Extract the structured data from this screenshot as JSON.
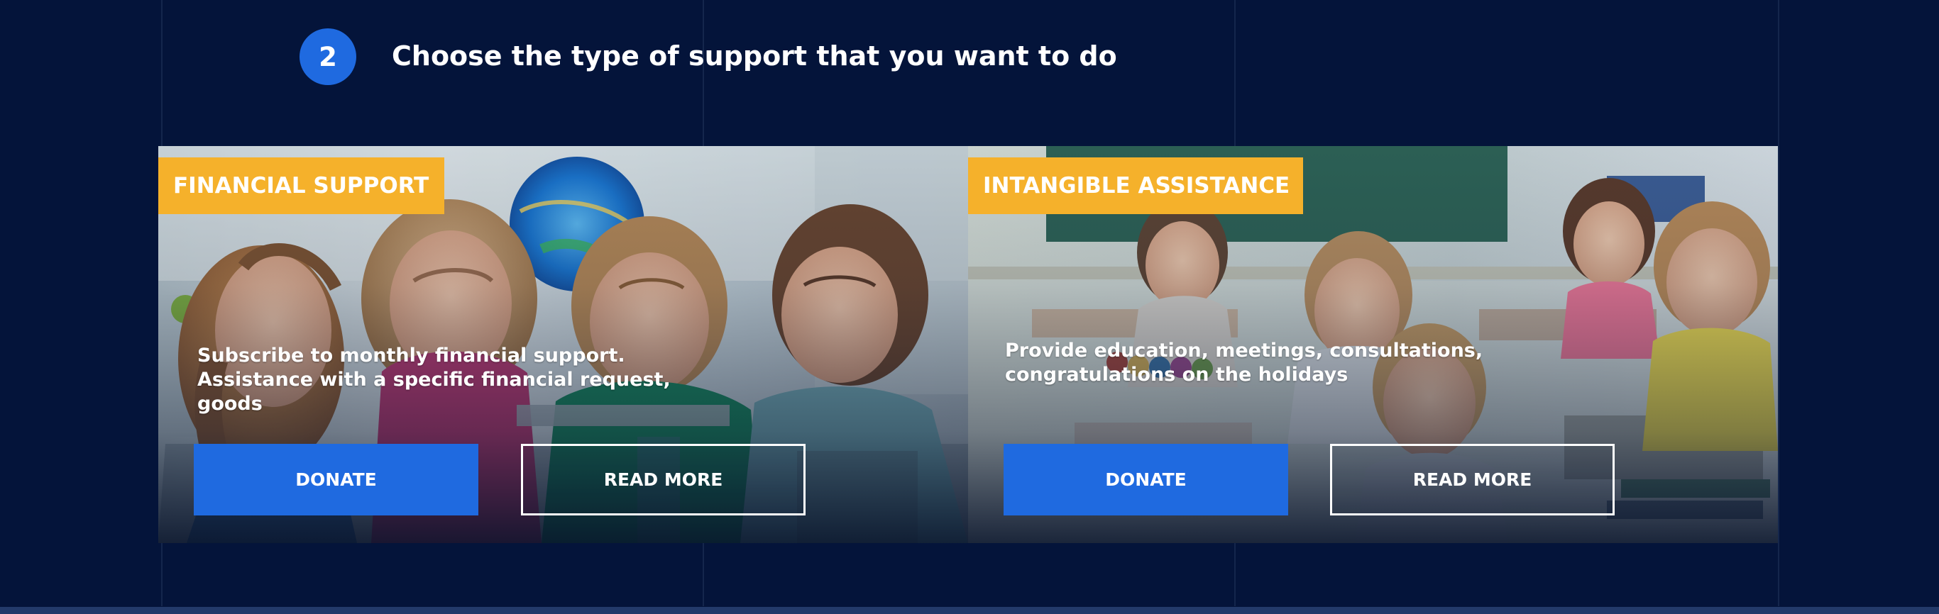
{
  "step": {
    "number": "2",
    "title": "Choose the type of support that you want to do"
  },
  "cards": [
    {
      "tag": "FINANCIAL SUPPORT",
      "description": "Subscribe to monthly financial support. Assistance with a specific financial request, goods",
      "donate_label": "DONATE",
      "read_more_label": "READ MORE"
    },
    {
      "tag": "INTANGIBLE ASSISTANCE",
      "description": "Provide education, meetings, consultations, congratulations on the holidays",
      "donate_label": "DONATE",
      "read_more_label": "READ MORE"
    }
  ],
  "colors": {
    "background": "#04143a",
    "accent_blue": "#1f6ae0",
    "tag_yellow": "#f5b12b",
    "text": "#ffffff"
  }
}
